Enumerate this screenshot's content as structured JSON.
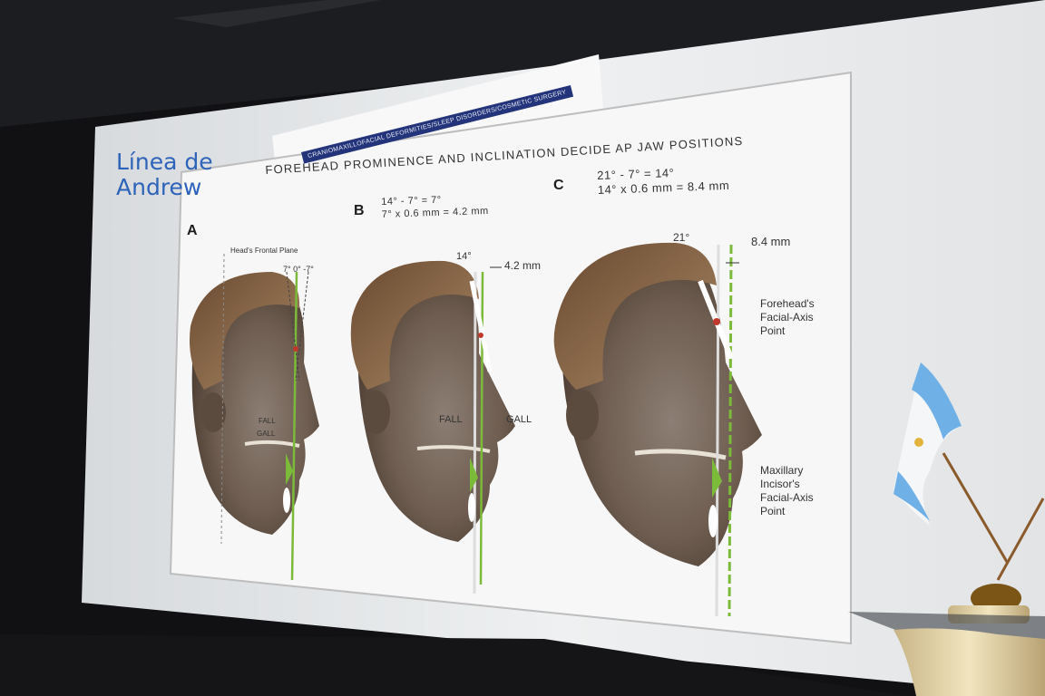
{
  "background_slide": {
    "title_line1": "Línea de",
    "title_line2": "Andrew"
  },
  "journal_banner": "CRANIOMAXILLOFACIAL DEFORMITIES/SLEEP DISORDERS/COSMETIC SURGERY",
  "figure": {
    "heading": "FOREHEAD PROMINENCE AND INCLINATION DECIDE AP JAW POSITIONS",
    "panel_a": {
      "letter": "A",
      "frontal_plane_label": "Head's Frontal Plane",
      "angles": "7°  0°  -7°",
      "fall_label": "FALL",
      "gall_label": "GALL"
    },
    "panel_b": {
      "letter": "B",
      "calc_line1": "14° - 7° = 7°",
      "calc_line2": "7° x 0.6 mm = 4.2 mm",
      "angle_label": "14°",
      "distance_label": "4.2 mm",
      "fall_label": "FALL",
      "gall_label": "GALL"
    },
    "panel_c": {
      "letter": "C",
      "calc_line1": "21° - 7° = 14°",
      "calc_line2": "14° x 0.6 mm = 8.4 mm",
      "angle_label": "21°",
      "distance_label": "8.4 mm",
      "forehead_point_line1": "Forehead's",
      "forehead_point_line2": "Facial-Axis",
      "forehead_point_line3": "Point",
      "incisor_point_line1": "Maxillary",
      "incisor_point_line2": "Incisor's",
      "incisor_point_line3": "Facial-Axis",
      "incisor_point_line4": "Point"
    }
  },
  "flag": {
    "name": "Argentina flag",
    "stripe_color": "#6fb0e6",
    "center_color": "#ffffff",
    "sun_color": "#e3b33b"
  },
  "colors": {
    "screen": "#e9ebec",
    "slide_paper": "#f6f6f6",
    "title_blue": "#2d63b8",
    "green_line": "#7cba3a",
    "room": "#0e0e10"
  }
}
